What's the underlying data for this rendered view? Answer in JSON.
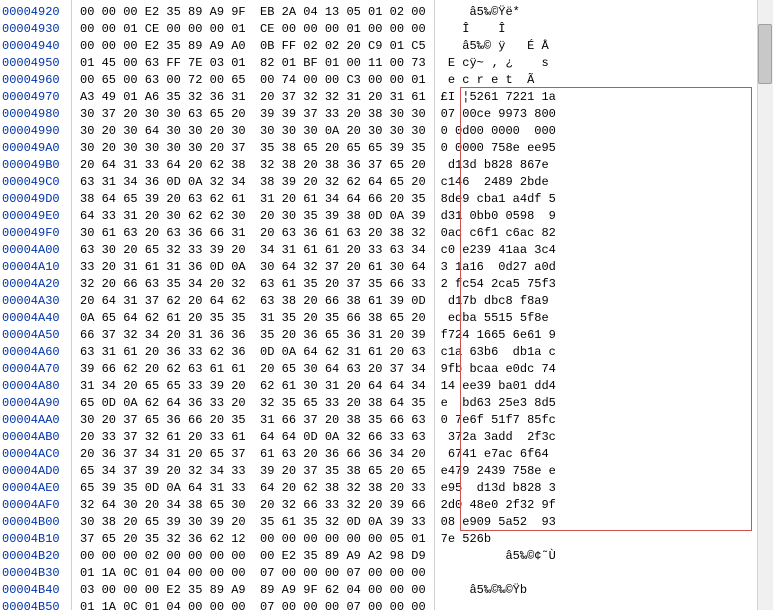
{
  "rows": [
    {
      "addr": "00004920",
      "hex": "00 00 00 E2 35 89 A9 9F  EB 2A 04 13 05 01 02 00",
      "ascii": "    â5‰©Ÿë*      "
    },
    {
      "addr": "00004930",
      "hex": "00 00 01 CE 00 00 00 01  CE 00 00 00 01 00 00 00",
      "ascii": "   Î    Î       "
    },
    {
      "addr": "00004940",
      "hex": "00 00 00 E2 35 89 A9 A0  0B FF 02 02 20 C9 01 C5",
      "ascii": "   â5‰© ÿ   É Å"
    },
    {
      "addr": "00004950",
      "hex": "01 45 00 63 FF 7E 03 01  82 01 BF 01 00 11 00 73",
      "ascii": " E cÿ~ ‚ ¿    s"
    },
    {
      "addr": "00004960",
      "hex": "00 65 00 63 00 72 00 65  00 74 00 00 C3 00 00 01",
      "ascii": " e c r e t  Ã   "
    },
    {
      "addr": "00004970",
      "hex": "A3 49 01 A6 35 32 36 31  20 37 32 32 31 20 31 61",
      "ascii": "£I ¦5261 7221 1a"
    },
    {
      "addr": "00004980",
      "hex": "30 37 20 30 30 63 65 20  39 39 37 33 20 38 30 30",
      "ascii": "07 00ce 9973 800"
    },
    {
      "addr": "00004990",
      "hex": "30 20 30 64 30 30 20 30  30 30 30 0A 20 30 30 30",
      "ascii": "0 0d00 0000  000"
    },
    {
      "addr": "000049A0",
      "hex": "30 20 30 30 30 30 20 37  35 38 65 20 65 65 39 35",
      "ascii": "0 0000 758e ee95"
    },
    {
      "addr": "000049B0",
      "hex": "20 64 31 33 64 20 62 38  32 38 20 38 36 37 65 20",
      "ascii": " d13d b828 867e "
    },
    {
      "addr": "000049C0",
      "hex": "63 31 34 36 0D 0A 32 34  38 39 20 32 62 64 65 20",
      "ascii": "c146  2489 2bde "
    },
    {
      "addr": "000049D0",
      "hex": "38 64 65 39 20 63 62 61  31 20 61 34 64 66 20 35",
      "ascii": "8de9 cba1 a4df 5"
    },
    {
      "addr": "000049E0",
      "hex": "64 33 31 20 30 62 62 30  20 30 35 39 38 0D 0A 39",
      "ascii": "d31 0bb0 0598  9"
    },
    {
      "addr": "000049F0",
      "hex": "30 61 63 20 63 36 66 31  20 63 36 61 63 20 38 32",
      "ascii": "0ac c6f1 c6ac 82"
    },
    {
      "addr": "00004A00",
      "hex": "63 30 20 65 32 33 39 20  34 31 61 61 20 33 63 34",
      "ascii": "c0 e239 41aa 3c4"
    },
    {
      "addr": "00004A10",
      "hex": "33 20 31 61 31 36 0D 0A  30 64 32 37 20 61 30 64",
      "ascii": "3 1a16  0d27 a0d"
    },
    {
      "addr": "00004A20",
      "hex": "32 20 66 63 35 34 20 32  63 61 35 20 37 35 66 33",
      "ascii": "2 fc54 2ca5 75f3"
    },
    {
      "addr": "00004A30",
      "hex": "20 64 31 37 62 20 64 62  63 38 20 66 38 61 39 0D",
      "ascii": " d17b dbc8 f8a9 "
    },
    {
      "addr": "00004A40",
      "hex": "0A 65 64 62 61 20 35 35  31 35 20 35 66 38 65 20",
      "ascii": " edba 5515 5f8e "
    },
    {
      "addr": "00004A50",
      "hex": "66 37 32 34 20 31 36 36  35 20 36 65 36 31 20 39",
      "ascii": "f724 1665 6e61 9"
    },
    {
      "addr": "00004A60",
      "hex": "63 31 61 20 36 33 62 36  0D 0A 64 62 31 61 20 63",
      "ascii": "c1a 63b6  db1a c"
    },
    {
      "addr": "00004A70",
      "hex": "39 66 62 20 62 63 61 61  20 65 30 64 63 20 37 34",
      "ascii": "9fb bcaa e0dc 74"
    },
    {
      "addr": "00004A80",
      "hex": "31 34 20 65 65 33 39 20  62 61 30 31 20 64 64 34",
      "ascii": "14 ee39 ba01 dd4"
    },
    {
      "addr": "00004A90",
      "hex": "65 0D 0A 62 64 36 33 20  32 35 65 33 20 38 64 35",
      "ascii": "e  bd63 25e3 8d5"
    },
    {
      "addr": "00004AA0",
      "hex": "30 20 37 65 36 66 20 35  31 66 37 20 38 35 66 63",
      "ascii": "0 7e6f 51f7 85fc"
    },
    {
      "addr": "00004AB0",
      "hex": "20 33 37 32 61 20 33 61  64 64 0D 0A 32 66 33 63",
      "ascii": " 372a 3add  2f3c"
    },
    {
      "addr": "00004AC0",
      "hex": "20 36 37 34 31 20 65 37  61 63 20 36 66 36 34 20",
      "ascii": " 6741 e7ac 6f64 "
    },
    {
      "addr": "00004AD0",
      "hex": "65 34 37 39 20 32 34 33  39 20 37 35 38 65 20 65",
      "ascii": "e479 2439 758e e"
    },
    {
      "addr": "00004AE0",
      "hex": "65 39 35 0D 0A 64 31 33  64 20 62 38 32 38 20 33",
      "ascii": "e95  d13d b828 3"
    },
    {
      "addr": "00004AF0",
      "hex": "32 64 30 20 34 38 65 30  20 32 66 33 32 20 39 66",
      "ascii": "2d0 48e0 2f32 9f"
    },
    {
      "addr": "00004B00",
      "hex": "30 38 20 65 39 30 39 20  35 61 35 32 0D 0A 39 33",
      "ascii": "08 e909 5a52  93"
    },
    {
      "addr": "00004B10",
      "hex": "37 65 20 35 32 36 62 12  00 00 00 00 00 00 05 01",
      "ascii": "7e 526b         "
    },
    {
      "addr": "00004B20",
      "hex": "00 00 00 02 00 00 00 00  00 E2 35 89 A9 A2 98 D9",
      "ascii": "         â5‰©¢˜Ù"
    },
    {
      "addr": "00004B30",
      "hex": "01 1A 0C 01 04 00 00 00  07 00 00 00 07 00 00 00",
      "ascii": "                "
    },
    {
      "addr": "00004B40",
      "hex": "03 00 00 00 E2 35 89 A9  89 A9 9F 62 04 00 00 00",
      "ascii": "    â5‰©‰©Ÿb    "
    },
    {
      "addr": "00004B50",
      "hex": "01 1A 0C 01 04 00 00 00  07 00 00 00 07 00 00 00",
      "ascii": "                "
    }
  ]
}
